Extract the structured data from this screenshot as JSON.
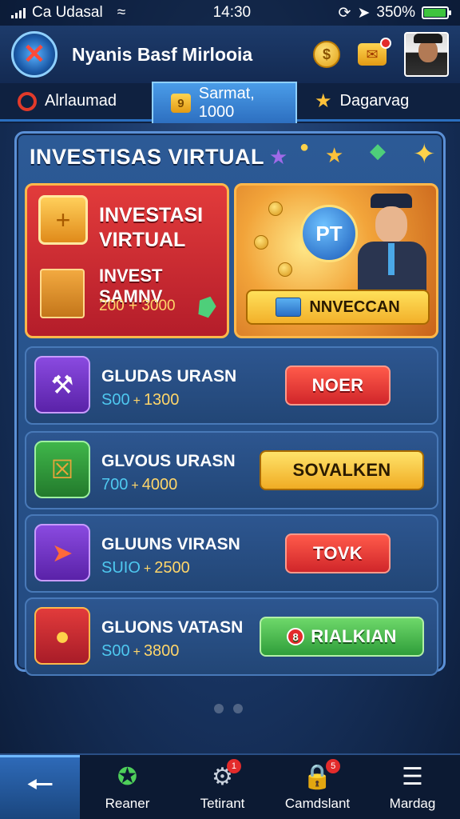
{
  "statusbar": {
    "carrier": "Ca Udasal",
    "time": "14:30",
    "battery": "350%",
    "battery_level": 0.95
  },
  "header": {
    "title": "Nyanis Basf Mirlooia",
    "coin_glyph": "$"
  },
  "tabs": [
    {
      "label": "Alrlaumad"
    },
    {
      "label": "Sarmat, 1000",
      "icon_text": "9"
    },
    {
      "label": "Dagarvag"
    }
  ],
  "panel": {
    "title": "INVESTISAS VIRTUAL"
  },
  "feature_left": {
    "title_line1": "INVESTASI",
    "title_line2": "VIRTUAL",
    "subtitle": "INVEST SAMNV",
    "range": "200 + 3000"
  },
  "feature_right": {
    "badge": "PT",
    "button_label": "NNVECCAN"
  },
  "rows": [
    {
      "name": "GLUDAS URASN",
      "low": "S00",
      "high": "1300",
      "button": "NOER",
      "button_style": "red"
    },
    {
      "name": "GLVOUS URASN",
      "low": "700",
      "high": "4000",
      "button": "SOVALKEN",
      "button_style": "yellow"
    },
    {
      "name": "GLUUNS VIRASN",
      "low": "SUIO",
      "high": "2500",
      "button": "TOVK",
      "button_style": "red"
    },
    {
      "name": "GLUONS VATASN",
      "low": "S00",
      "high": "3800",
      "button": "RIALKIAN",
      "button_style": "green",
      "button_badge": "8"
    }
  ],
  "bottom_nav": [
    {
      "label": "Reaner",
      "icon": "award-icon"
    },
    {
      "label": "Tetirant",
      "icon": "gear-icon",
      "badge": "1"
    },
    {
      "label": "Camdslant",
      "icon": "lock-icon",
      "badge": "5"
    },
    {
      "label": "Mardag",
      "icon": "menu-icon"
    }
  ],
  "colors": {
    "red_button": "#d0262a",
    "yellow_button": "#f0ac24",
    "green_button": "#2f9e3a",
    "panel": "#234a80"
  }
}
